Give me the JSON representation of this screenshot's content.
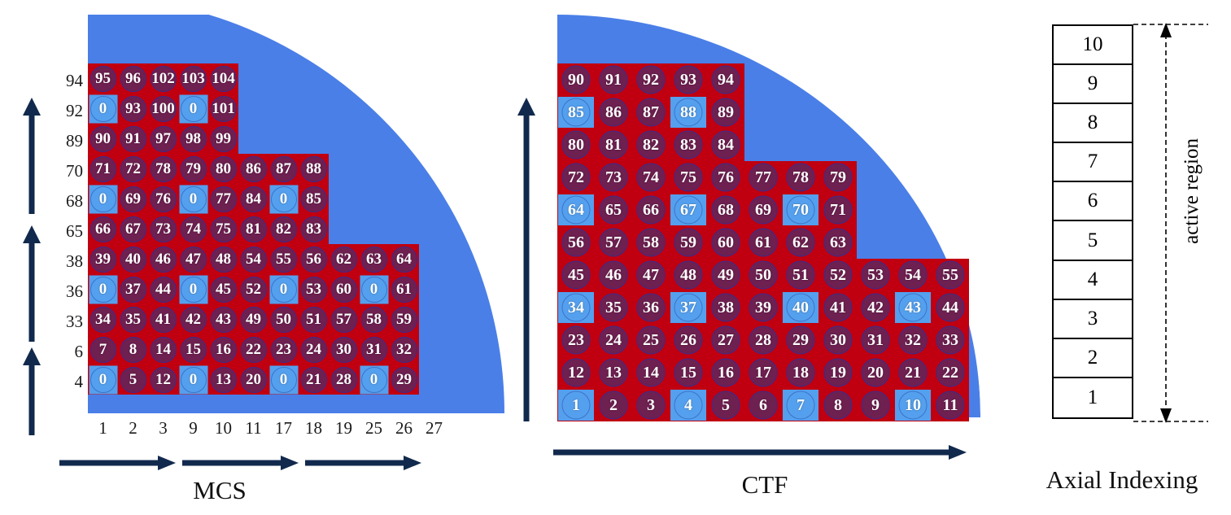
{
  "colors": {
    "vessel_blue": "#4a7fe8",
    "fuel_red": "#c00010",
    "pin_purple": "#6e2050",
    "guide_tube_blue": "#54a0ee",
    "arrow_navy": "#11294d",
    "text_white": "#ffffff",
    "text_black": "#111111"
  },
  "mcs": {
    "caption": "MCS",
    "row_labels": [
      "94",
      "92",
      "89",
      "70",
      "68",
      "65",
      "38",
      "36",
      "33",
      "6",
      "4"
    ],
    "col_labels": [
      "1",
      "2",
      "3",
      "9",
      "10",
      "11",
      "17",
      "18",
      "19",
      "25",
      "26",
      "27"
    ],
    "rows": [
      [
        "95",
        "96",
        "102",
        "103",
        "104"
      ],
      [
        "0",
        "93",
        "100",
        "0",
        "101"
      ],
      [
        "90",
        "91",
        "97",
        "98",
        "99"
      ],
      [
        "71",
        "72",
        "78",
        "79",
        "80",
        "86",
        "87",
        "88"
      ],
      [
        "0",
        "69",
        "76",
        "0",
        "77",
        "84",
        "0",
        "85"
      ],
      [
        "66",
        "67",
        "73",
        "74",
        "75",
        "81",
        "82",
        "83"
      ],
      [
        "39",
        "40",
        "46",
        "47",
        "48",
        "54",
        "55",
        "56",
        "62",
        "63",
        "64"
      ],
      [
        "0",
        "37",
        "44",
        "0",
        "45",
        "52",
        "0",
        "53",
        "60",
        "0",
        "61"
      ],
      [
        "34",
        "35",
        "41",
        "42",
        "43",
        "49",
        "50",
        "51",
        "57",
        "58",
        "59"
      ],
      [
        "7",
        "8",
        "14",
        "15",
        "16",
        "22",
        "23",
        "24",
        "30",
        "31",
        "32"
      ],
      [
        "0",
        "5",
        "12",
        "0",
        "13",
        "20",
        "0",
        "21",
        "28",
        "0",
        "29"
      ]
    ],
    "guide_tubes": [
      [],
      [
        0,
        3
      ],
      [],
      [],
      [
        0,
        3,
        6
      ],
      [],
      [],
      [
        0,
        3,
        6,
        9
      ],
      [],
      [],
      [
        0,
        3,
        6,
        9
      ]
    ]
  },
  "ctf": {
    "caption": "CTF",
    "rows": [
      [
        "90",
        "91",
        "92",
        "93",
        "94"
      ],
      [
        "85",
        "86",
        "87",
        "88",
        "89"
      ],
      [
        "80",
        "81",
        "82",
        "83",
        "84"
      ],
      [
        "72",
        "73",
        "74",
        "75",
        "76",
        "77",
        "78",
        "79"
      ],
      [
        "64",
        "65",
        "66",
        "67",
        "68",
        "69",
        "70",
        "71"
      ],
      [
        "56",
        "57",
        "58",
        "59",
        "60",
        "61",
        "62",
        "63"
      ],
      [
        "45",
        "46",
        "47",
        "48",
        "49",
        "50",
        "51",
        "52",
        "53",
        "54",
        "55"
      ],
      [
        "34",
        "35",
        "36",
        "37",
        "38",
        "39",
        "40",
        "41",
        "42",
        "43",
        "44"
      ],
      [
        "23",
        "24",
        "25",
        "26",
        "27",
        "28",
        "29",
        "30",
        "31",
        "32",
        "33"
      ],
      [
        "12",
        "13",
        "14",
        "15",
        "16",
        "17",
        "18",
        "19",
        "20",
        "21",
        "22"
      ],
      [
        "1",
        "2",
        "3",
        "4",
        "5",
        "6",
        "7",
        "8",
        "9",
        "10",
        "11"
      ]
    ],
    "guide_tubes": [
      [],
      [
        0,
        3
      ],
      [],
      [],
      [
        0,
        3,
        6
      ],
      [],
      [],
      [
        0,
        3,
        6,
        9
      ],
      [],
      [],
      [
        0,
        3,
        6,
        9
      ]
    ]
  },
  "axial": {
    "caption": "Axial Indexing",
    "region_label": "active region",
    "levels": [
      "10",
      "9",
      "8",
      "7",
      "6",
      "5",
      "4",
      "3",
      "2",
      "1"
    ]
  }
}
